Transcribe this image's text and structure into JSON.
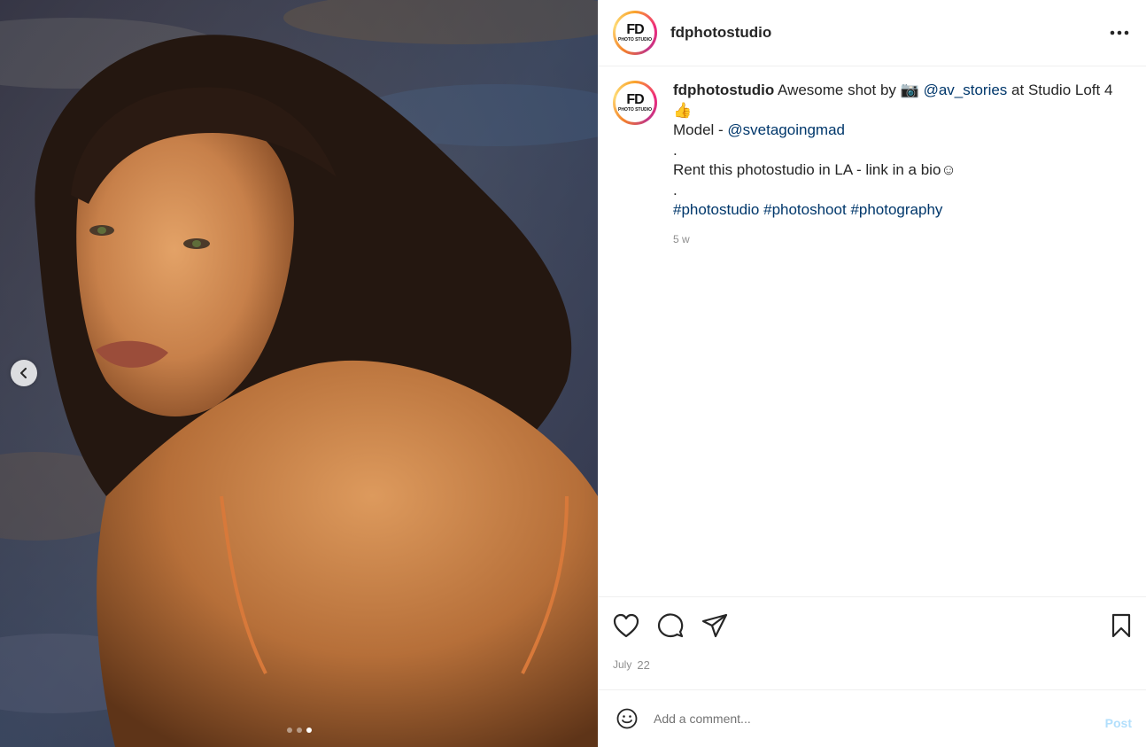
{
  "account": {
    "username": "fdphotostudio",
    "avatar_logo": "FD",
    "avatar_logo_sub": "PHOTO STUDIO"
  },
  "media": {
    "slide_count": 3,
    "active_slide": 3
  },
  "caption": {
    "username": "fdphotostudio",
    "text_1": "Awesome shot by",
    "camera_emoji": "📷",
    "mention_photographer": "@av_stories",
    "text_2": "at Studio Loft 4",
    "thumbs_emoji": "👍",
    "model_label": "Model - ",
    "mention_model": "@svetagoingmad",
    "dot_1": ".",
    "rent_text": "Rent this photostudio in LA - link in a bio",
    "smile_emoji": "☺",
    "dot_2": ".",
    "hashtags": [
      "#photostudio",
      "#photoshoot",
      "#photography"
    ],
    "time_ago": "5 w"
  },
  "actions": {
    "like_icon": "heart-icon",
    "comment_icon": "comment-icon",
    "share_icon": "paper-plane-icon",
    "save_icon": "bookmark-icon"
  },
  "date": {
    "month": "July",
    "day": "22"
  },
  "comment": {
    "placeholder": "Add a comment...",
    "post_label": "Post"
  },
  "colors": {
    "link": "#00376b",
    "muted": "#8e8e8e",
    "post_disabled": "#b2dffc"
  }
}
